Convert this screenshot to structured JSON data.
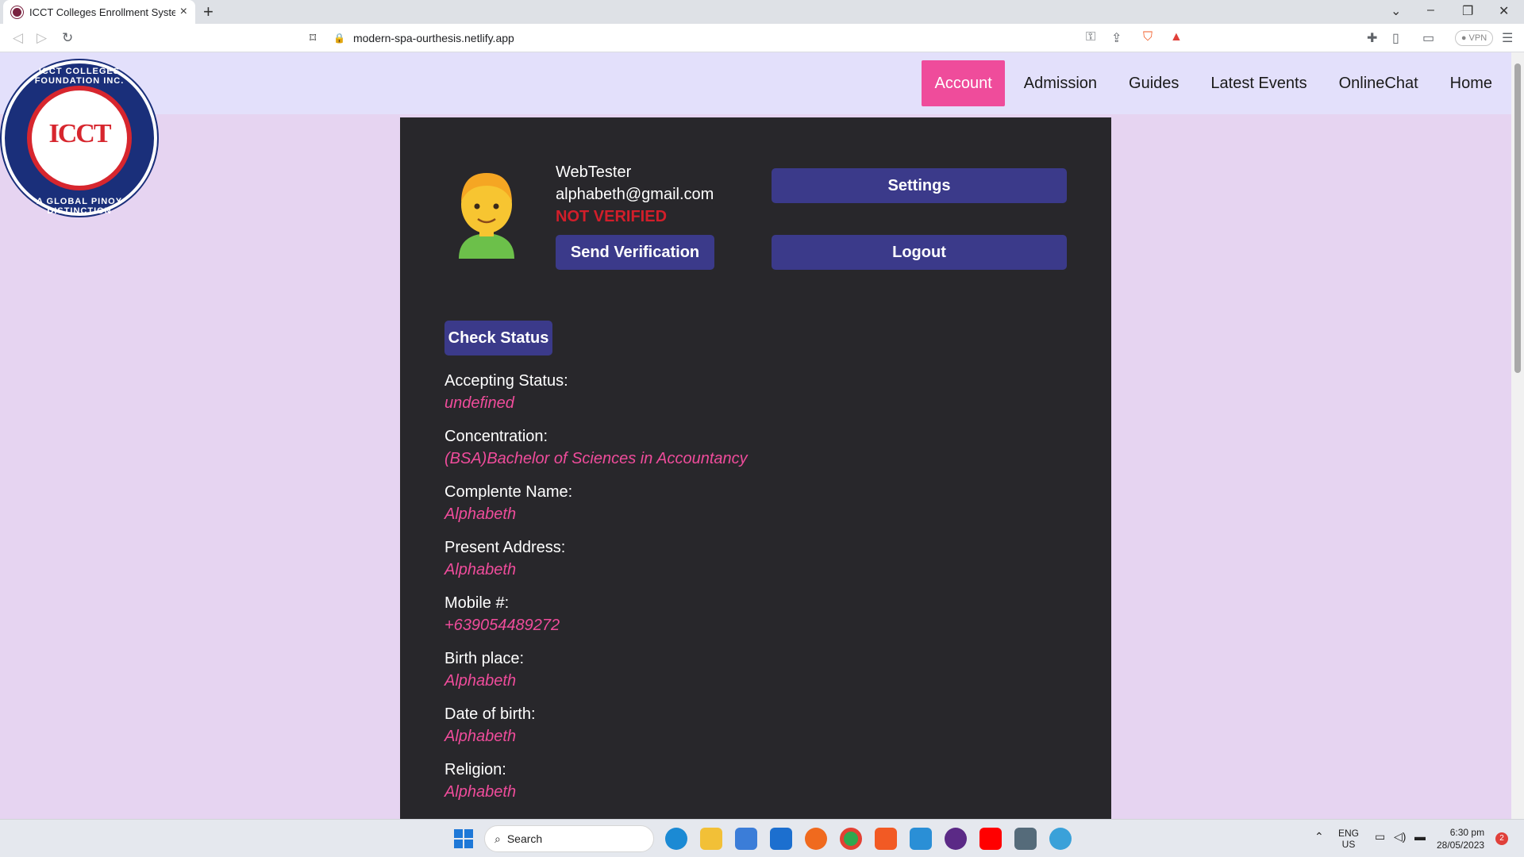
{
  "browser": {
    "tab_title": "ICCT Colleges Enrollment System",
    "url": "modern-spa-ourthesis.netlify.app",
    "vpn_label": "VPN"
  },
  "logo": {
    "top_text": "ICCT COLLEGES FOUNDATION INC.",
    "bottom_text": "A GLOBAL PINOY DISTINCTION",
    "monogram": "ICCT"
  },
  "nav": {
    "items": [
      {
        "label": "Account",
        "active": true
      },
      {
        "label": "Admission",
        "active": false
      },
      {
        "label": "Guides",
        "active": false
      },
      {
        "label": "Latest Events",
        "active": false
      },
      {
        "label": "OnlineChat",
        "active": false
      },
      {
        "label": "Home",
        "active": false
      }
    ]
  },
  "profile": {
    "username": "WebTester",
    "email": "alphabeth@gmail.com",
    "verification_status": "NOT VERIFIED",
    "send_verification_label": "Send Verification",
    "settings_label": "Settings",
    "logout_label": "Logout",
    "check_status_label": "Check Status"
  },
  "fields": [
    {
      "label": "Accepting Status:",
      "value": "undefined"
    },
    {
      "label": "Concentration:",
      "value": "(BSA)Bachelor of Sciences in Accountancy"
    },
    {
      "label": "Complente Name:",
      "value": "Alphabeth"
    },
    {
      "label": "Present Address:",
      "value": "Alphabeth"
    },
    {
      "label": "Mobile #:",
      "value": "+639054489272"
    },
    {
      "label": "Birth place:",
      "value": "Alphabeth"
    },
    {
      "label": "Date of birth:",
      "value": "Alphabeth"
    },
    {
      "label": "Religion:",
      "value": "Alphabeth"
    }
  ],
  "taskbar": {
    "search_placeholder": "Search",
    "lang_top": "ENG",
    "lang_bottom": "US",
    "time": "6:30 pm",
    "date": "28/05/2023",
    "notification_count": "2"
  },
  "colors": {
    "accent_pink": "#ef4c9b",
    "button_blue": "#3b3a8a",
    "card_bg": "#28272b",
    "error_red": "#d21e2a"
  }
}
